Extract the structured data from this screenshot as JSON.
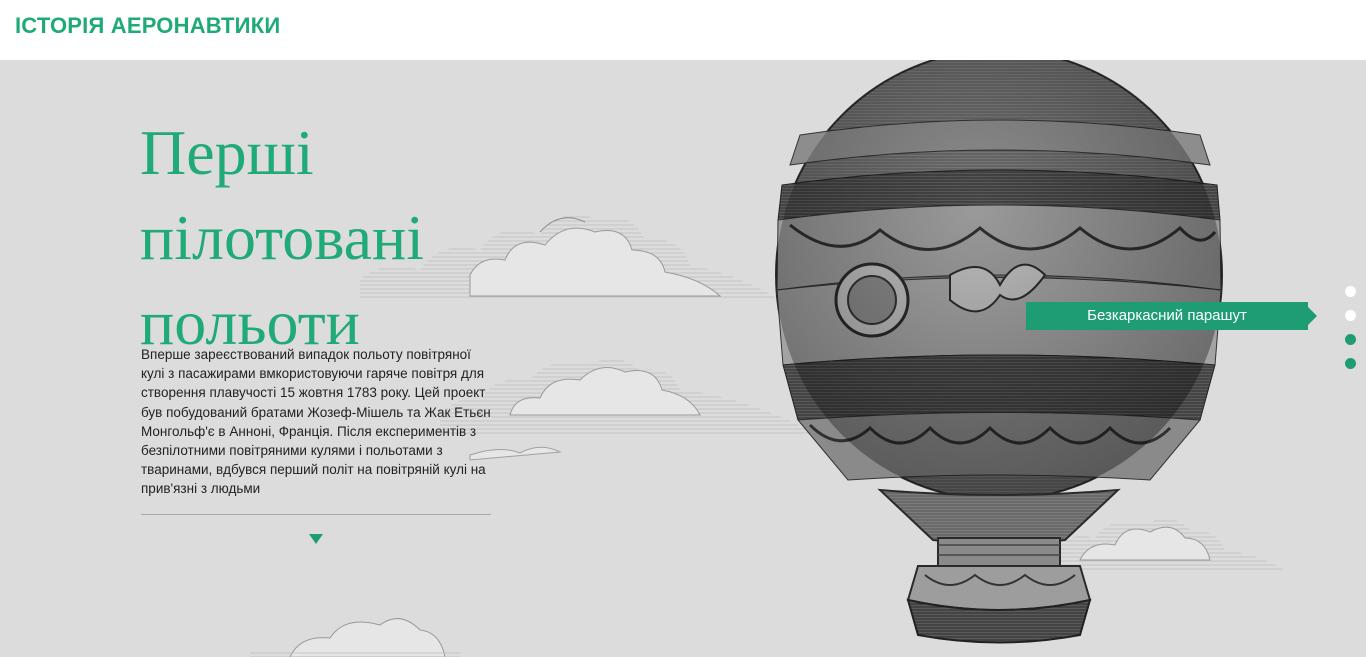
{
  "header": {
    "site_title": "ІСТОРІЯ АЕРОНАВТИКИ"
  },
  "hero": {
    "headline_lines": [
      "Перші",
      "пілотовані",
      "польоти"
    ],
    "description": "Вперше зареєствований випадок польоту повітряної кулі з пасажирами вмкористовуючи гаряче повітря для створення плавучості 15 жовтня 1783 року. Цей проект був побудований братами Жозеф-Мішель та Жак Етьєн Монгольф'є в Анноні, Франція. Після експериментів з безпілотними повітряними кулями і польотами з тваринами, вдбувся перший політ на повітряній кулі на прив'язні з людьми",
    "tag_label": "Безкаркасний парашут",
    "scroll_icon": "triangle-down-icon",
    "illustration": "hot-air-balloon-engraving"
  },
  "pagination": {
    "total": 4,
    "states": [
      "inactive",
      "inactive",
      "active",
      "active"
    ]
  },
  "colors": {
    "accent": "#1faa78",
    "tag_bg": "#1e9d74",
    "hero_bg": "#dcdcdc"
  }
}
